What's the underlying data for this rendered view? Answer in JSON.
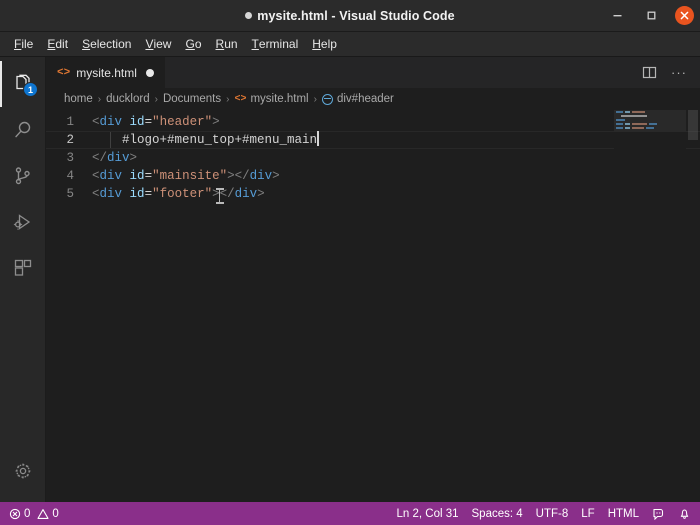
{
  "window": {
    "title": "mysite.html - Visual Studio Code",
    "dirty_indicator": "●",
    "controls": {
      "minimize": "—",
      "maximize": "❐",
      "close": "✕"
    }
  },
  "menubar": {
    "items": [
      {
        "mnemonic": "F",
        "rest": "ile"
      },
      {
        "mnemonic": "E",
        "rest": "dit"
      },
      {
        "mnemonic": "S",
        "rest": "election"
      },
      {
        "mnemonic": "V",
        "rest": "iew"
      },
      {
        "mnemonic": "G",
        "rest": "o"
      },
      {
        "mnemonic": "R",
        "rest": "un"
      },
      {
        "mnemonic": "T",
        "rest": "erminal"
      },
      {
        "mnemonic": "H",
        "rest": "elp"
      }
    ]
  },
  "activitybar": {
    "items": [
      {
        "name": "explorer",
        "badge": "1",
        "active": true
      },
      {
        "name": "search",
        "badge": "",
        "active": false
      },
      {
        "name": "source-control",
        "badge": "",
        "active": false
      },
      {
        "name": "run-and-debug",
        "badge": "",
        "active": false
      },
      {
        "name": "extensions",
        "badge": "",
        "active": false
      }
    ],
    "manage": {
      "name": "manage-settings-gear"
    }
  },
  "tabs": {
    "items": [
      {
        "icon": "<>",
        "label": "mysite.html",
        "dirty": true,
        "active": true
      }
    ],
    "actions": [
      {
        "name": "split-editor-right"
      },
      {
        "name": "more-actions",
        "label": "···"
      }
    ]
  },
  "breadcrumbs": {
    "items": [
      {
        "label": "home",
        "icon": ""
      },
      {
        "label": "ducklord",
        "icon": ""
      },
      {
        "label": "Documents",
        "icon": ""
      },
      {
        "label": "mysite.html",
        "icon": "html"
      },
      {
        "label": "div#header",
        "icon": "symbol"
      }
    ],
    "separator": "›"
  },
  "editor": {
    "lines": [
      {
        "number": "1",
        "active": false,
        "tokens": [
          {
            "t": "<",
            "c": "punct"
          },
          {
            "t": "div",
            "c": "tag"
          },
          {
            "t": " ",
            "c": "plain"
          },
          {
            "t": "id",
            "c": "attr"
          },
          {
            "t": "=",
            "c": "eq"
          },
          {
            "t": "\"header\"",
            "c": "str"
          },
          {
            "t": ">",
            "c": "punct"
          }
        ]
      },
      {
        "number": "2",
        "active": true,
        "tokens": [
          {
            "t": "    #logo+#menu_top+#menu_main",
            "c": "plain"
          }
        ]
      },
      {
        "number": "3",
        "active": false,
        "tokens": [
          {
            "t": "</",
            "c": "punct"
          },
          {
            "t": "div",
            "c": "tag"
          },
          {
            "t": ">",
            "c": "punct"
          }
        ]
      },
      {
        "number": "4",
        "active": false,
        "tokens": [
          {
            "t": "<",
            "c": "punct"
          },
          {
            "t": "div",
            "c": "tag"
          },
          {
            "t": " ",
            "c": "plain"
          },
          {
            "t": "id",
            "c": "attr"
          },
          {
            "t": "=",
            "c": "eq"
          },
          {
            "t": "\"mainsite\"",
            "c": "str"
          },
          {
            "t": ">",
            "c": "punct"
          },
          {
            "t": "</",
            "c": "punct"
          },
          {
            "t": "div",
            "c": "tag"
          },
          {
            "t": ">",
            "c": "punct"
          }
        ]
      },
      {
        "number": "5",
        "active": false,
        "tokens": [
          {
            "t": "<",
            "c": "punct"
          },
          {
            "t": "div",
            "c": "tag"
          },
          {
            "t": " ",
            "c": "plain"
          },
          {
            "t": "id",
            "c": "attr"
          },
          {
            "t": "=",
            "c": "eq"
          },
          {
            "t": "\"footer\"",
            "c": "str"
          },
          {
            "t": ">",
            "c": "punct"
          },
          {
            "t": "</",
            "c": "punct"
          },
          {
            "t": "div",
            "c": "tag"
          },
          {
            "t": ">",
            "c": "punct"
          }
        ]
      }
    ],
    "cursor_line": 2,
    "full_text": "<div id=\"header\">\n    #logo+#menu_top+#menu_main\n</div>\n<div id=\"mainsite\"></div>\n<div id=\"footer\"></div>"
  },
  "statusbar": {
    "errors": "0",
    "warnings": "0",
    "position": "Ln 2, Col 31",
    "indentation": "Spaces: 4",
    "encoding": "UTF-8",
    "eol": "LF",
    "language": "HTML",
    "feedback_icon": "smiley-feedback-icon",
    "notifications_icon": "bell-icon",
    "background": "#8a2f8a"
  },
  "colors": {
    "editor_background": "#1e1e1e",
    "chrome_background": "#2b2b2b",
    "activitybar_background": "#282828",
    "tab_inactive_background": "#252526",
    "accent_badge": "#0e75d0",
    "close_button": "#e9541f",
    "token_tag": "#569cd6",
    "token_attribute": "#9cdcfe",
    "token_string": "#ce9178",
    "token_punctuation": "#808080",
    "token_plain": "#d4d4d4"
  }
}
